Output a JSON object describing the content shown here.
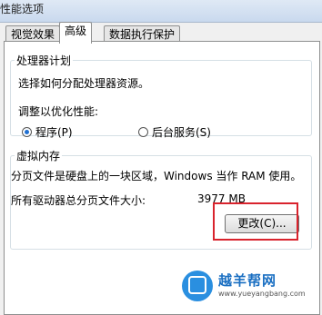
{
  "window": {
    "title": "性能选项"
  },
  "tabs": [
    {
      "label": "视觉效果",
      "active": false
    },
    {
      "label": "高级",
      "active": true
    },
    {
      "label": "数据执行保护",
      "active": false
    }
  ],
  "processor_scheduling": {
    "group_title": "处理器计划",
    "description": "选择如何分配处理器资源。",
    "adjust_label": "调整以优化性能:",
    "options": [
      {
        "label": "程序(P)",
        "selected": true
      },
      {
        "label": "后台服务(S)",
        "selected": false
      }
    ]
  },
  "virtual_memory": {
    "group_title": "虚拟内存",
    "description": "分页文件是硬盘上的一块区域，Windows 当作 RAM 使用。",
    "total_label": "所有驱动器总分页文件大小:",
    "total_value": "3977 MB",
    "change_button": "更改(C)..."
  },
  "highlight_color": "#d9232d",
  "watermark": {
    "name": "越羊帮网",
    "url": "www.yueyangbang.com",
    "logo_icon": "wifi-house-icon"
  }
}
